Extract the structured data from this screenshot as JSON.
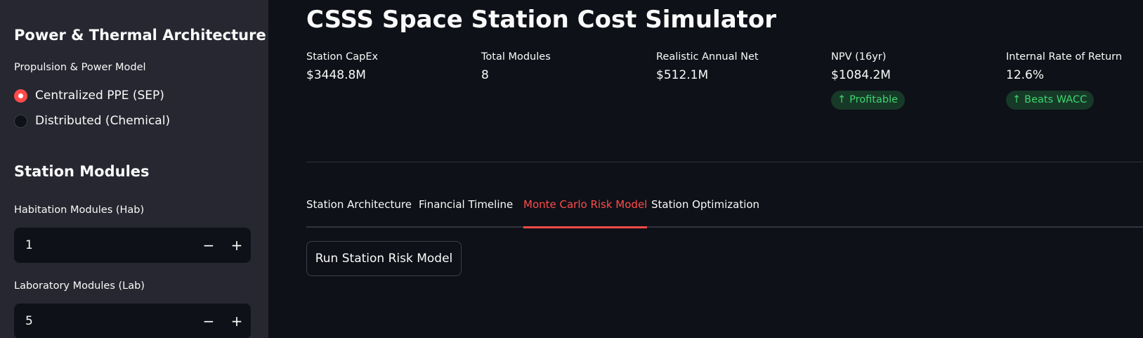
{
  "sidebar": {
    "power_heading": "Power & Thermal Architecture",
    "propulsion_label": "Propulsion & Power Model",
    "propulsion_options": [
      {
        "label": "Centralized PPE (SEP)",
        "selected": true
      },
      {
        "label": "Distributed (Chemical)",
        "selected": false
      }
    ],
    "modules_heading": "Station Modules",
    "hab_label": "Habitation Modules (Hab)",
    "hab_value": "1",
    "lab_label": "Laboratory Modules (Lab)",
    "lab_value": "5",
    "minus_symbol": "−",
    "plus_symbol": "+"
  },
  "main": {
    "title": "CSSS Space Station Cost Simulator",
    "metrics": [
      {
        "label": "Station CapEx",
        "value": "$3448.8M"
      },
      {
        "label": "Total Modules",
        "value": "8"
      },
      {
        "label": "Realistic Annual Net",
        "value": "$512.1M"
      },
      {
        "label": "NPV (16yr)",
        "value": "$1084.2M",
        "delta": "Profitable"
      },
      {
        "label": "Internal Rate of Return",
        "value": "12.6%",
        "delta": "Beats WACC"
      }
    ],
    "delta_arrow": "↑",
    "tabs": [
      {
        "label": "Station Architecture",
        "active": false
      },
      {
        "label": "Financial Timeline",
        "active": false
      },
      {
        "label": "Monte Carlo Risk Model",
        "active": true
      },
      {
        "label": "Station Optimization",
        "active": false
      }
    ],
    "run_button_label": "Run Station Risk Model"
  },
  "colors": {
    "accent": "#ff4b4b",
    "background": "#0e1117",
    "sidebar": "#262730",
    "delta_positive_text": "#3dd56d",
    "delta_positive_bg": "#173928"
  }
}
